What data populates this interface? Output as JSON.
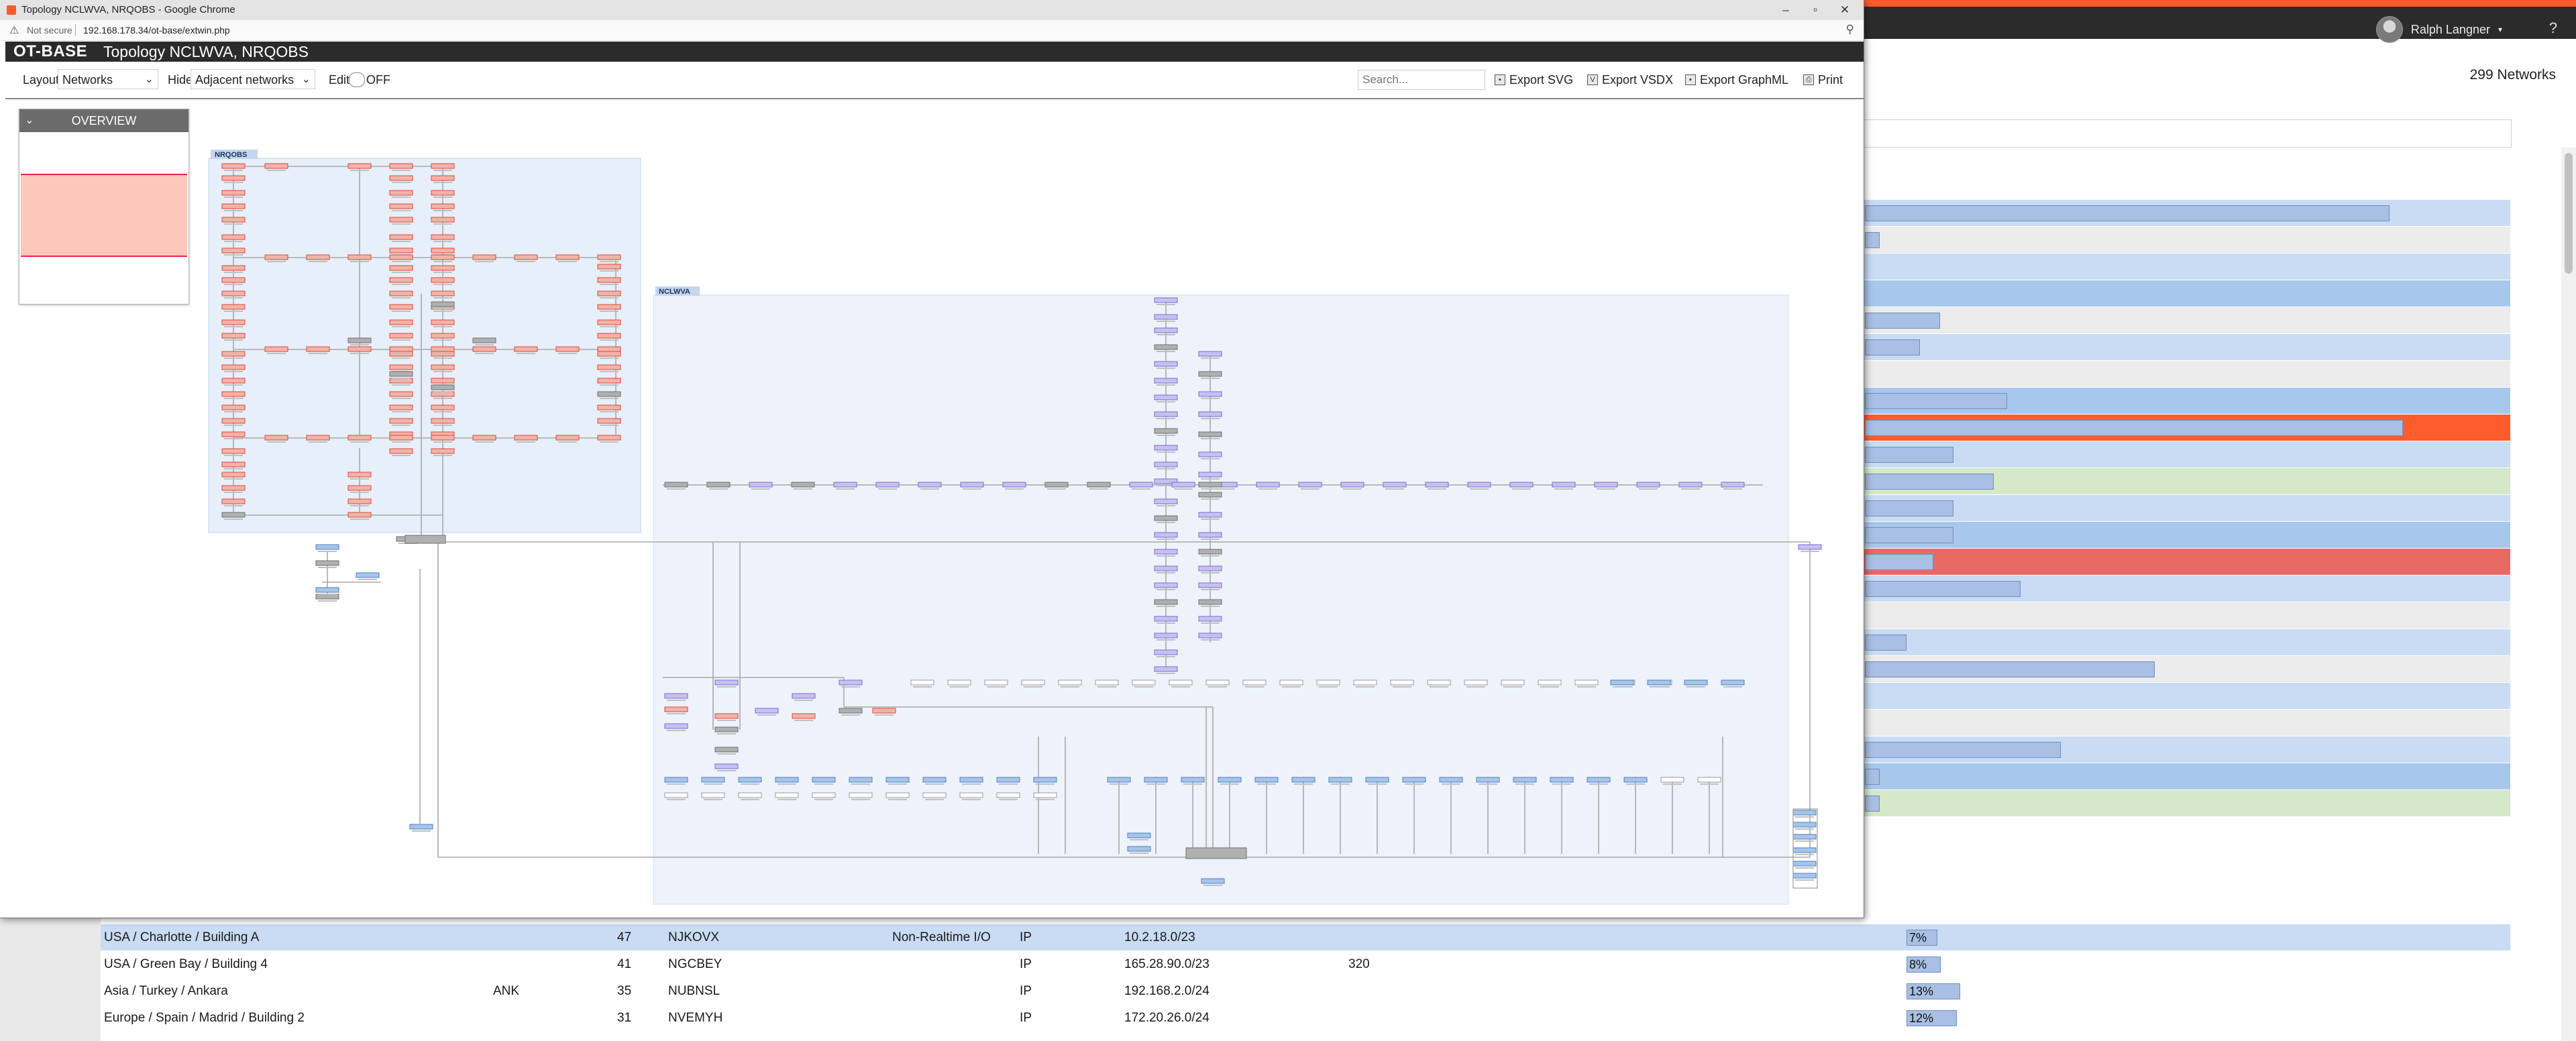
{
  "window": {
    "title": "Topology NCLWVA, NRQOBS - Google Chrome",
    "not_secure": "Not secure",
    "url": "192.168.178.34/ot-base/extwin.php"
  },
  "app": {
    "logo": "OT-BASE",
    "title": "Topology NCLWVA, NRQOBS"
  },
  "toolbar": {
    "layout_label": "Layout",
    "layout_value": "Networks",
    "hide_label": "Hide",
    "hide_value": "Adjacent networks",
    "edit_label": "Edit",
    "edit_state": "OFF",
    "search_placeholder": "Search...",
    "export_svg": "Export SVG",
    "export_vsdx": "Export VSDX",
    "export_graphml": "Export GraphML",
    "print": "Print"
  },
  "overview": {
    "title": "OVERVIEW"
  },
  "topology": {
    "groups": [
      {
        "name": "NRQOBS",
        "color": "#e8503e"
      },
      {
        "name": "NCLWVA",
        "color": "#9b8ee0"
      }
    ],
    "colors": {
      "nrqobs_node": "#f2b3a8",
      "nrqobs_border": "#d9493a",
      "nclwva_node": "#c8c0f2",
      "nclwva_border": "#7a6cd0",
      "switch_node": "#b0b0b0",
      "uplink_node": "#a6c5ea",
      "plain_node": "#ffffff"
    }
  },
  "background": {
    "user_name": "Ralph Langner",
    "networks_count": "299 Networks",
    "row_colors": [
      "#c9dcf3",
      "#ececec",
      "#c9dcf3",
      "#a8c7ec",
      "#ececec",
      "#c9dcf3",
      "#ececec",
      "#a8c7ec",
      "#ff5c2e",
      "#c9dcf3",
      "#d5e8c8",
      "#c9dcf3",
      "#a8c7ec",
      "#e86a62",
      "#c9dcf3",
      "#ececec",
      "#c9dcf3",
      "#ececec",
      "#c9dcf3",
      "#ececec",
      "#c9dcf3",
      "#a8c7ec",
      "#d5e8c8"
    ],
    "rows": [
      {
        "location": "USA / Charlotte / Building A",
        "code": "",
        "count": "47",
        "name": "NJKOVX",
        "type": "Non-Realtime I/O",
        "proto": "IP",
        "subnet": "10.2.18.0/23",
        "vlan": "",
        "pct": "7%",
        "pct_value": 7
      },
      {
        "location": "USA / Green Bay / Building 4",
        "code": "",
        "count": "41",
        "name": "NGCBEY",
        "type": "",
        "proto": "IP",
        "subnet": "165.28.90.0/23",
        "vlan": "320",
        "pct": "8%",
        "pct_value": 8
      },
      {
        "location": "Asia / Turkey / Ankara",
        "code": "ANK",
        "count": "35",
        "name": "NUBNSL",
        "type": "",
        "proto": "IP",
        "subnet": "192.168.2.0/24",
        "vlan": "",
        "pct": "13%",
        "pct_value": 13
      },
      {
        "location": "Europe / Spain / Madrid / Building 2",
        "code": "",
        "count": "31",
        "name": "NVEMYH",
        "type": "",
        "proto": "IP",
        "subnet": "172.20.26.0/24",
        "vlan": "",
        "pct": "12%",
        "pct_value": 12
      }
    ]
  }
}
